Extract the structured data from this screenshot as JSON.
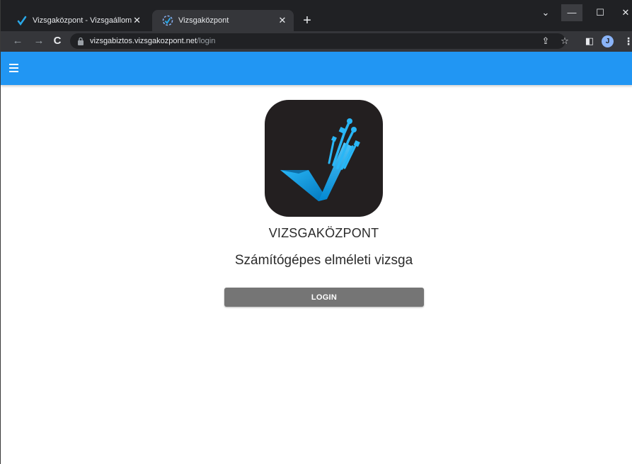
{
  "browser": {
    "tabs": [
      {
        "title": "Vizsgaközpont - Vizsgaállomás",
        "close": "✕",
        "active": false
      },
      {
        "title": "Vizsgaközpont",
        "close": "✕",
        "active": true
      }
    ],
    "new_tab": "+",
    "window_controls": {
      "dropdown": "⌄",
      "minimize": "—",
      "maximize": "☐",
      "close": "✕"
    },
    "nav": {
      "back": "←",
      "forward": "→",
      "reload": "C"
    },
    "url": {
      "host": "vizsgabiztos.vizsgakozpont.net",
      "path": "/login"
    },
    "toolbar_icons": {
      "share": "⇪",
      "star": "☆",
      "sidepanel": "◧"
    },
    "profile_initial": "J",
    "menu": "⋮"
  },
  "app": {
    "appbar_color": "#2196f3",
    "brand": "VIZSGAKÖZPONT",
    "subtitle": "Számítógépes elméleti vizsga",
    "login_label": "LOGIN",
    "login_color": "#757575"
  },
  "icons": {
    "menu": "hamburger-icon",
    "logo": "checkmark-circuit-logo",
    "lock": "lock-icon"
  }
}
